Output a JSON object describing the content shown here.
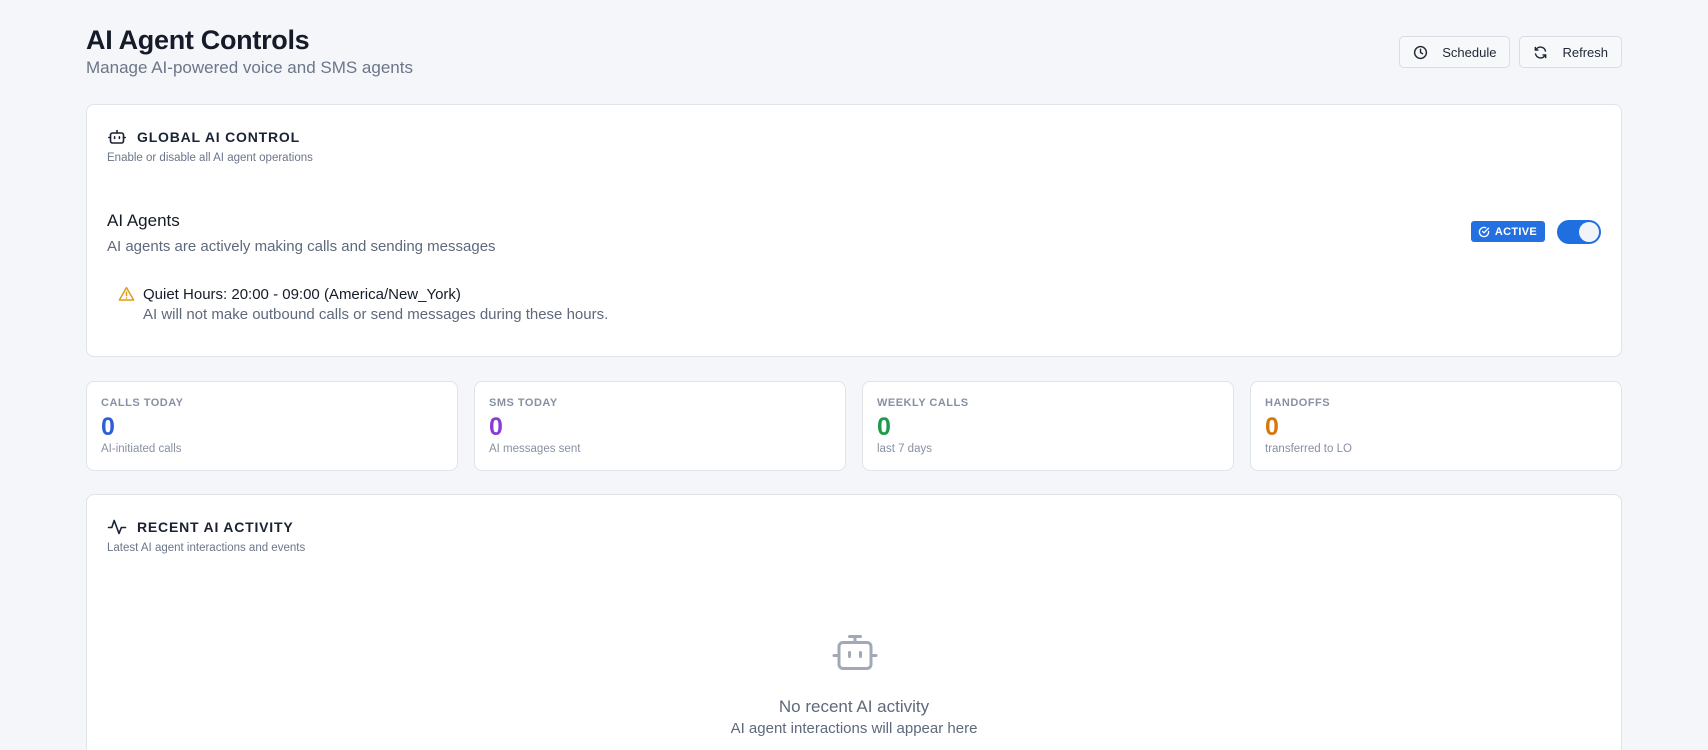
{
  "header": {
    "title": "AI Agent Controls",
    "subtitle": "Manage AI-powered voice and SMS agents",
    "schedule_label": "Schedule",
    "refresh_label": "Refresh"
  },
  "global_control": {
    "title": "GLOBAL AI CONTROL",
    "description": "Enable or disable all AI agent operations",
    "agents_title": "AI Agents",
    "agents_description": "AI agents are actively making calls and sending messages",
    "status_badge": "ACTIVE",
    "toggle_on": true,
    "quiet_hours_title": "Quiet Hours: 20:00 - 09:00 (America/New_York)",
    "quiet_hours_description": "AI will not make outbound calls or send messages during these hours."
  },
  "stats": [
    {
      "label": "CALLS TODAY",
      "value": "0",
      "sub": "AI-initiated calls",
      "color": "#2f5fd6"
    },
    {
      "label": "SMS TODAY",
      "value": "0",
      "sub": "AI messages sent",
      "color": "#8a3bd6"
    },
    {
      "label": "WEEKLY CALLS",
      "value": "0",
      "sub": "last 7 days",
      "color": "#1f9a4a"
    },
    {
      "label": "HANDOFFS",
      "value": "0",
      "sub": "transferred to LO",
      "color": "#d9770f"
    }
  ],
  "activity": {
    "title": "RECENT AI ACTIVITY",
    "description": "Latest AI agent interactions and events",
    "empty_title": "No recent AI activity",
    "empty_description": "AI agent interactions will appear here"
  },
  "colors": {
    "accent": "#1f6fe0",
    "warning": "#e29a1b"
  },
  "icons": {
    "schedule": "clock-icon",
    "refresh": "refresh-icon",
    "global_control": "bot-icon",
    "status": "check-circle-icon",
    "quiet_hours": "warning-icon",
    "activity": "activity-icon",
    "empty": "bot-icon"
  }
}
